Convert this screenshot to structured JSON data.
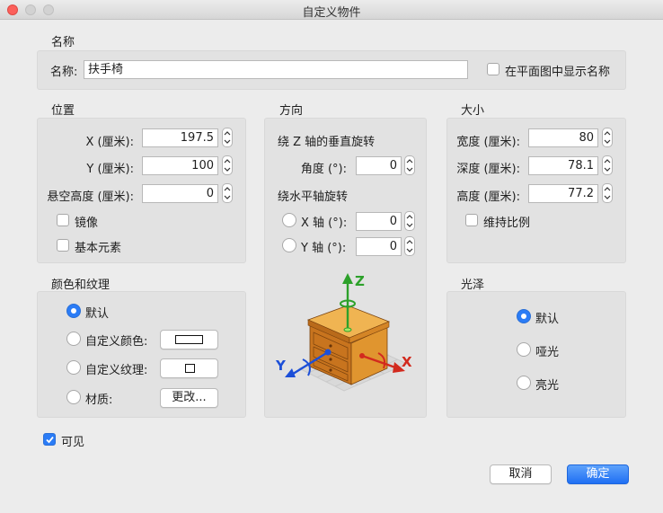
{
  "window": {
    "title": "自定义物件"
  },
  "name_section": {
    "title": "名称",
    "label": "名称:",
    "value": "扶手椅",
    "show_in_plan_label": "在平面图中显示名称",
    "show_in_plan_checked": false
  },
  "position_section": {
    "title": "位置",
    "x_label": "X (厘米):",
    "x_value": "197.5",
    "y_label": "Y (厘米):",
    "y_value": "100",
    "elevation_label": "悬空高度 (厘米):",
    "elevation_value": "0",
    "mirror_label": "镜像",
    "mirror_checked": false,
    "basic_element_label": "基本元素",
    "basic_element_checked": false
  },
  "orientation_section": {
    "title": "方向",
    "vertical_rotation_title": "绕 Z 轴的垂直旋转",
    "angle_label": "角度 (°):",
    "angle_value": "0",
    "horizontal_rotation_title": "绕水平轴旋转",
    "x_axis_label": "X 轴 (°):",
    "x_axis_value": "0",
    "y_axis_label": "Y 轴 (°):",
    "y_axis_value": "0",
    "axis_z_letter": "Z",
    "axis_x_letter": "X",
    "axis_y_letter": "Y"
  },
  "size_section": {
    "title": "大小",
    "width_label": "宽度 (厘米):",
    "width_value": "80",
    "depth_label": "深度 (厘米):",
    "depth_value": "78.1",
    "height_label": "高度 (厘米):",
    "height_value": "77.2",
    "keep_proportions_label": "维持比例",
    "keep_proportions_checked": false
  },
  "color_section": {
    "title": "颜色和纹理",
    "default_label": "默认",
    "custom_color_label": "自定义颜色:",
    "custom_texture_label": "自定义纹理:",
    "material_label": "材质:",
    "modify_button": "更改...",
    "selected": "default"
  },
  "shininess_section": {
    "title": "光泽",
    "default_label": "默认",
    "matt_label": "哑光",
    "shiny_label": "亮光",
    "selected": "default"
  },
  "visible": {
    "label": "可见",
    "checked": true
  },
  "buttons": {
    "cancel": "取消",
    "ok": "确定"
  },
  "colors": {
    "accent": "#2b7cf6",
    "close": "#fc605b",
    "axis_x": "#d22a1e",
    "axis_y": "#1c4fd8",
    "axis_z": "#2da12a",
    "wood": "#d68a2c"
  },
  "icons": [
    "close-icon",
    "minimize-icon",
    "maximize-icon",
    "stepper-icon",
    "checkmark-icon",
    "nightstand-3d-preview"
  ]
}
